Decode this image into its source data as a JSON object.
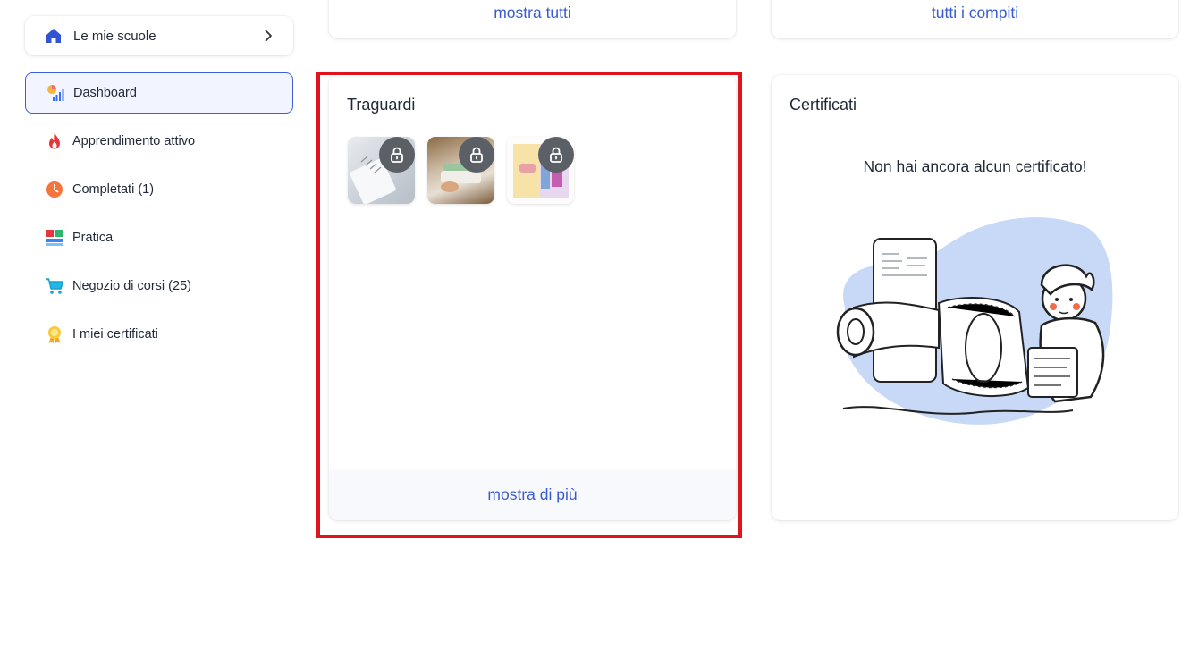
{
  "sidebar": {
    "school_switch": {
      "label": "Le mie scuole"
    },
    "items": [
      {
        "label": "Dashboard",
        "icon": "dashboard-chart-icon",
        "active": true
      },
      {
        "label": "Apprendimento attivo",
        "icon": "flame-icon"
      },
      {
        "label": "Completati (1)",
        "icon": "clock-icon"
      },
      {
        "label": "Pratica",
        "icon": "grid-blocks-icon"
      },
      {
        "label": "Negozio di corsi (25)",
        "icon": "shopping-cart-icon"
      },
      {
        "label": "I miei certificati",
        "icon": "award-ribbon-icon"
      }
    ]
  },
  "top_cards": {
    "left_link": "mostra tutti",
    "right_link": "tutti i compiti"
  },
  "traguardi": {
    "title": "Traguardi",
    "badges": [
      {
        "icon": "lock-icon",
        "locked": true
      },
      {
        "icon": "lock-icon",
        "locked": true
      },
      {
        "icon": "lock-icon",
        "locked": true
      }
    ],
    "footer_link": "mostra di più"
  },
  "certificati": {
    "title": "Certificati",
    "empty_message": "Non hai ancora alcun certificato!"
  },
  "colors": {
    "accent": "#3a5bd0",
    "highlight": "#e0141c",
    "active_nav_bg": "#f2f5ff"
  }
}
